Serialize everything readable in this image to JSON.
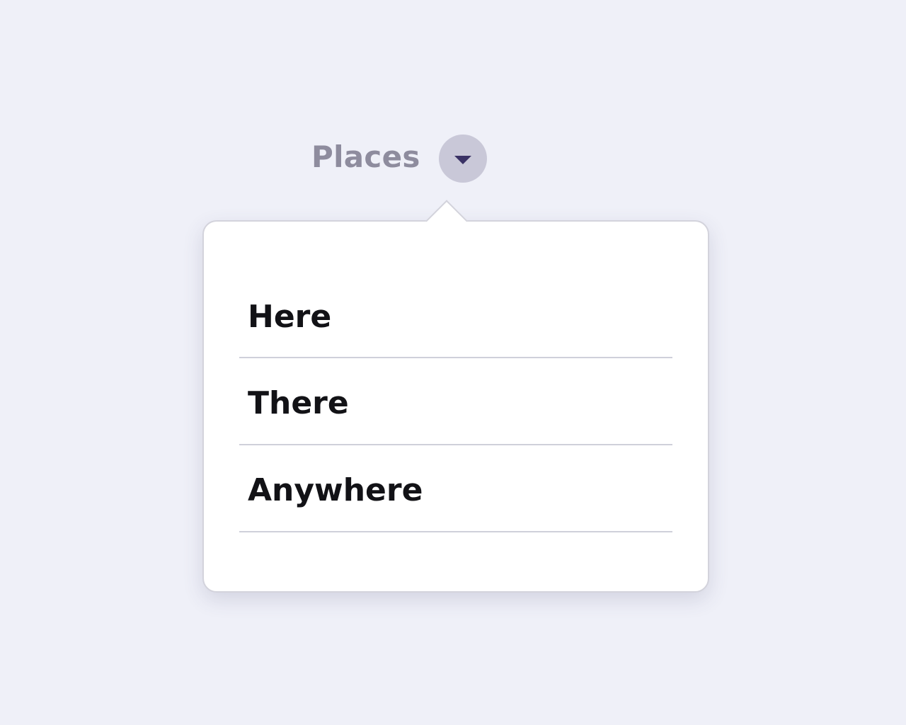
{
  "dropdown": {
    "label": "Places",
    "toggle_icon": "caret-down-icon",
    "expanded": true,
    "options": [
      {
        "label": "Here"
      },
      {
        "label": "There"
      },
      {
        "label": "Anywhere"
      }
    ]
  },
  "colors": {
    "background": "#eff0f8",
    "label": "#8e8c9e",
    "toggle_bg": "#c9c8d8",
    "caret": "#3a3265",
    "option_text": "#121216",
    "divider": "#cfd0da"
  }
}
